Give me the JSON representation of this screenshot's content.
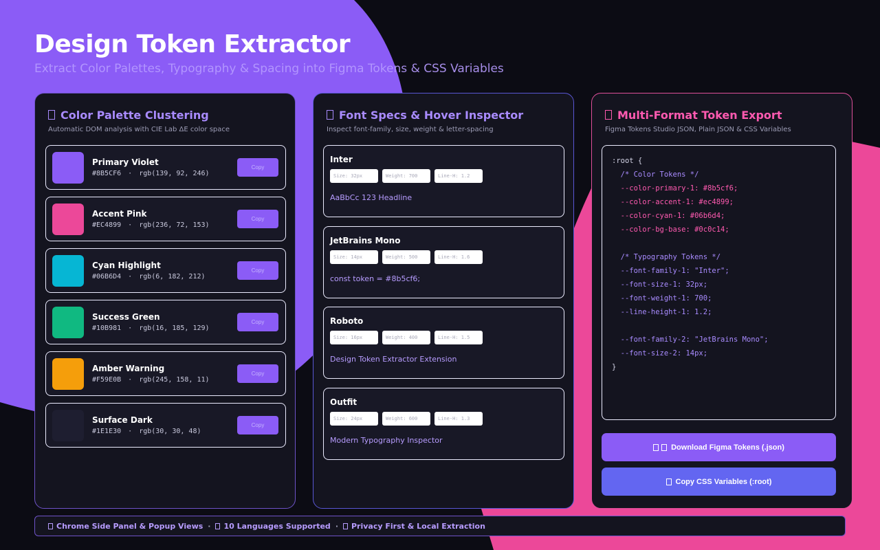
{
  "header": {
    "title": "Design Token Extractor",
    "subtitle": "Extract Color Palettes, Typography & Spacing into Figma Tokens & CSS Variables"
  },
  "colors_panel": {
    "title": "Color Palette Clustering",
    "icon": "palette-icon",
    "subtitle": "Automatic DOM analysis with CIE Lab ΔE color space",
    "copy_label": "Copy",
    "items": [
      {
        "name": "Primary Violet",
        "hex": "#8B5CF6",
        "rgb": "rgb(139, 92, 246)",
        "swatch": "#8b5cf6"
      },
      {
        "name": "Accent Pink",
        "hex": "#EC4899",
        "rgb": "rgb(236, 72, 153)",
        "swatch": "#ec4899"
      },
      {
        "name": "Cyan Highlight",
        "hex": "#06B6D4",
        "rgb": "rgb(6, 182, 212)",
        "swatch": "#06b6d4"
      },
      {
        "name": "Success Green",
        "hex": "#10B981",
        "rgb": "rgb(16, 185, 129)",
        "swatch": "#10b981"
      },
      {
        "name": "Amber Warning",
        "hex": "#F59E0B",
        "rgb": "rgb(245, 158, 11)",
        "swatch": "#f59e0b"
      },
      {
        "name": "Surface Dark",
        "hex": "#1E1E30",
        "rgb": "rgb(30, 30, 48)",
        "swatch": "#1e1e30"
      }
    ]
  },
  "fonts_panel": {
    "title": "Font Specs & Hover Inspector",
    "icon": "text-icon",
    "subtitle": "Inspect font-family, size, weight & letter-spacing",
    "items": [
      {
        "family": "Inter",
        "size": "Size: 32px",
        "weight": "Weight: 700",
        "line_height": "Line-H: 1.2",
        "sample": "AaBbCc 123 Headline"
      },
      {
        "family": "JetBrains Mono",
        "size": "Size: 14px",
        "weight": "Weight: 500",
        "line_height": "Line-H: 1.6",
        "sample": "const token = #8b5cf6;"
      },
      {
        "family": "Roboto",
        "size": "Size: 16px",
        "weight": "Weight: 400",
        "line_height": "Line-H: 1.5",
        "sample": "Design Token Extractor Extension"
      },
      {
        "family": "Outfit",
        "size": "Size: 24px",
        "weight": "Weight: 600",
        "line_height": "Line-H: 1.3",
        "sample": "Modern Typography Inspector"
      }
    ]
  },
  "export_panel": {
    "title": "Multi-Format Token Export",
    "icon": "export-icon",
    "subtitle": "Figma Tokens Studio JSON, Plain JSON & CSS Variables",
    "code_lines": [
      {
        "text": ":root {",
        "kind": "brace"
      },
      {
        "text": "  /* Color Tokens */",
        "kind": "comment"
      },
      {
        "text": "  --color-primary-1: #8b5cf6;",
        "kind": "color"
      },
      {
        "text": "  --color-accent-1: #ec4899;",
        "kind": "color"
      },
      {
        "text": "  --color-cyan-1: #06b6d4;",
        "kind": "color"
      },
      {
        "text": "  --color-bg-base: #0c0c14;",
        "kind": "color"
      },
      {
        "text": "",
        "kind": "plain"
      },
      {
        "text": "  /* Typography Tokens */",
        "kind": "comment"
      },
      {
        "text": "  --font-family-1: \"Inter\";",
        "kind": "type"
      },
      {
        "text": "  --font-size-1: 32px;",
        "kind": "type"
      },
      {
        "text": "  --font-weight-1: 700;",
        "kind": "type"
      },
      {
        "text": "  --line-height-1: 1.2;",
        "kind": "type"
      },
      {
        "text": "",
        "kind": "plain"
      },
      {
        "text": "  --font-family-2: \"JetBrains Mono\";",
        "kind": "type"
      },
      {
        "text": "  --font-size-2: 14px;",
        "kind": "type"
      },
      {
        "text": "}",
        "kind": "brace"
      }
    ],
    "download_label": "Download Figma Tokens (.json)",
    "download_icon": "download-icon",
    "copy_css_label": "Copy CSS Variables (:root)",
    "copy_css_icon": "clipboard-icon"
  },
  "footer": {
    "items": [
      "Chrome Side Panel & Popup Views",
      "10 Languages Supported",
      "Privacy First & Local Extraction"
    ],
    "separator": "·"
  },
  "theme": {
    "violet": "#8b5cf6",
    "pink": "#ec4899",
    "indigo": "#6366f1",
    "background": "#0c0c14"
  }
}
